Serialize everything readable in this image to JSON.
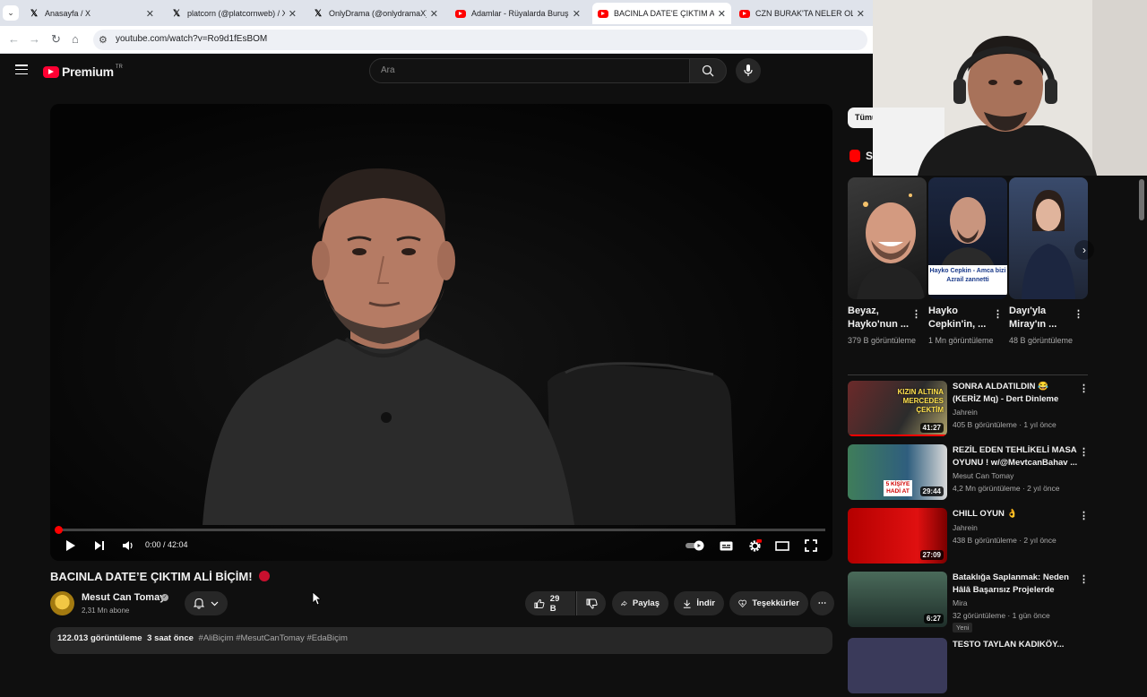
{
  "browser": {
    "tabs": [
      {
        "title": "Anasayfa / X",
        "icon": "x-logo"
      },
      {
        "title": "platcorn (@platcornweb) / X",
        "icon": "x-logo"
      },
      {
        "title": "OnlyDrama (@onlydramaX) / X",
        "icon": "x-logo"
      },
      {
        "title": "Adamlar - Rüyalarda Buruşmuş",
        "icon": "youtube-logo"
      },
      {
        "title": "BACINLA DATE'E ÇIKTIM ALİ BİÇİM",
        "icon": "youtube-logo"
      },
      {
        "title": "CZN BURAK'TA NELER OLUYOR",
        "icon": "youtube-logo"
      }
    ],
    "url": "youtube.com/watch?v=Ro9d1fEsBOM"
  },
  "header": {
    "logo_text": "Premium",
    "country": "TR",
    "search_placeholder": "Ara"
  },
  "player": {
    "time": "0:00 / 42:04",
    "progress": 0
  },
  "video": {
    "title": "BACINLA DATE’E ÇIKTIM ALİ BİÇİM!",
    "channel": "Mesut Can Tomay",
    "subscribers": "2,31 Mn abone",
    "likes": "29 B",
    "share": "Paylaş",
    "download": "İndir",
    "thanks": "Teşekkürler",
    "views": "122.013 görüntüleme",
    "age": "3 saat önce",
    "hashtags": "#AliBiçim #MesutCanTomay #EdaBiçim"
  },
  "sidebar": {
    "chip": "Tümü",
    "shorts_label": "S",
    "shorts": [
      {
        "title": "Beyaz, Hayko'nun ...",
        "views": "379 B görüntüleme"
      },
      {
        "title": "Hayko Cepkin'in, ...",
        "views": "1 Mn görüntüleme",
        "overlay": "Hayko Cepkin - Amca bizi Azrail zannetti"
      },
      {
        "title": "Dayı'yla Miray'ın ...",
        "views": "48 B görüntüleme"
      }
    ],
    "recommendations": [
      {
        "title": "SONRA ALDATILDIN 😂 (KERİZ Mq) - Dert Dinleme Gecesi ...",
        "channel": "Jahrein",
        "meta": "405 B görüntüleme · 1 yıl önce",
        "duration": "41:27",
        "thumb_text": "KIZIN ALTINA MERCEDES ÇEKTİM"
      },
      {
        "title": "REZİL EDEN TEHLİKELİ MASA OYUNU ! w/@MevtcanBahav ...",
        "channel": "Mesut Can Tomay",
        "meta": "4,2 Mn görüntüleme · 2 yıl önce",
        "duration": "29:44",
        "thumb_text": "5 KİŞİYE HADİ AT"
      },
      {
        "title": "CHILL OYUN 👌",
        "channel": "Jahrein",
        "meta": "438 B görüntüleme · 2 yıl önce",
        "duration": "27:09",
        "thumb_text": ""
      },
      {
        "title": "Bataklığa Saplanmak: Neden Hâlâ Başarısız Projelerde Israr...",
        "channel": "Mira",
        "meta": "32 görüntüleme · 1 gün önce",
        "duration": "6:27",
        "badge": "Yeni",
        "thumb_text": ""
      },
      {
        "title": "TESTO TAYLAN KADIKÖY...",
        "channel": "",
        "meta": "",
        "duration": "",
        "thumb_text": ""
      }
    ]
  },
  "colors": {
    "background": "#0f0f0f",
    "accent_red": "#ff0000",
    "chip_bg": "#272727",
    "muted_text": "#aaaaaa"
  }
}
